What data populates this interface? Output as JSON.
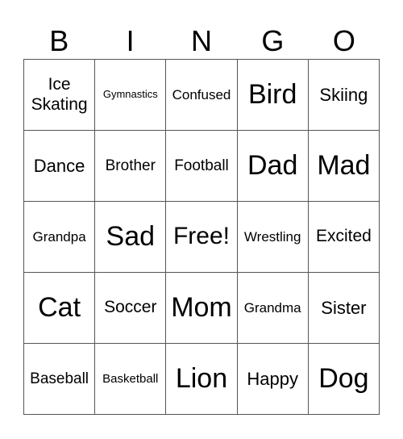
{
  "header": [
    "B",
    "I",
    "N",
    "G",
    "O"
  ],
  "cells": [
    "Ice Skating",
    "Gymnastics",
    "Confused",
    "Bird",
    "Skiing",
    "Dance",
    "Brother",
    "Football",
    "Dad",
    "Mad",
    "Grandpa",
    "Sad",
    "Free!",
    "Wrestling",
    "Excited",
    "Cat",
    "Soccer",
    "Mom",
    "Grandma",
    "Sister",
    "Baseball",
    "Basketball",
    "Lion",
    "Happy",
    "Dog"
  ]
}
